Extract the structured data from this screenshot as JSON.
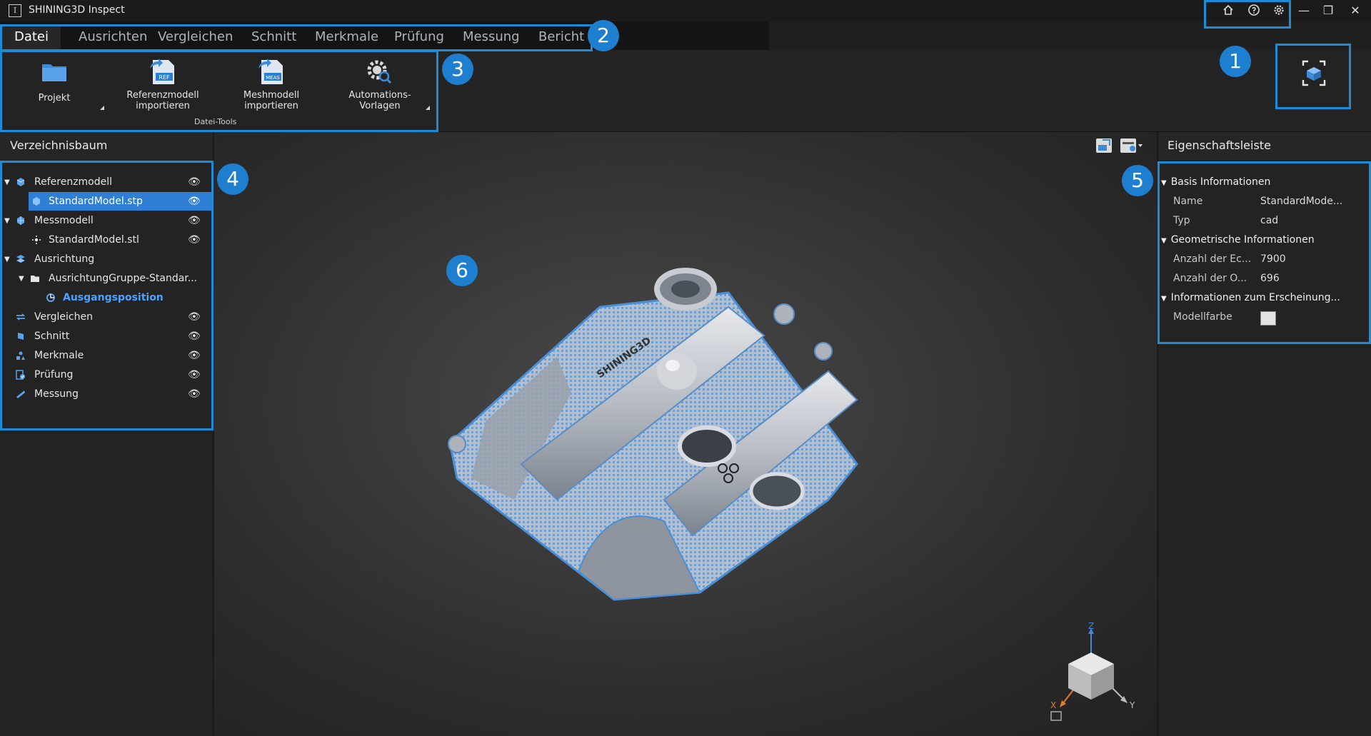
{
  "app": {
    "title": "SHINING3D Inspect",
    "logo_glyph": "I"
  },
  "titlebar_icons": [
    "home-icon",
    "help-icon",
    "settings-icon"
  ],
  "window_controls": {
    "minimize": "—",
    "maximize": "❐",
    "close": "✕"
  },
  "menu": {
    "tabs": [
      {
        "label": "Datei",
        "active": true
      },
      {
        "label": "Ausrichten"
      },
      {
        "label": "Vergleichen"
      },
      {
        "label": "Schnitt"
      },
      {
        "label": "Merkmale"
      },
      {
        "label": "Prüfung"
      },
      {
        "label": "Messung"
      },
      {
        "label": "Bericht"
      }
    ]
  },
  "ribbon": {
    "buttons": [
      {
        "label": "Projekt",
        "icon": "folder-icon"
      },
      {
        "label": "Referenzmodell\nimportieren",
        "icon": "import-ref-icon",
        "tag": "REF"
      },
      {
        "label": "Meshmodell\nimportieren",
        "icon": "import-mesh-icon",
        "tag": "MEAS"
      },
      {
        "label": "Automations-\nVorlagen",
        "icon": "gear-search-icon"
      }
    ],
    "group_label": "Datei-Tools"
  },
  "tree_panel": {
    "title": "Verzeichnisbaum",
    "items": [
      {
        "label": "Referenzmodell",
        "icon": "reference-model-icon",
        "expanded": true,
        "eye": true
      },
      {
        "label": "StandardModel.stp",
        "icon": "cad-part-icon",
        "selected": true,
        "eye": true
      },
      {
        "label": "Messmodell",
        "icon": "mesh-model-icon",
        "expanded": true,
        "eye": true
      },
      {
        "label": "StandardModel.stl",
        "icon": "point-cloud-icon",
        "eye": true
      },
      {
        "label": "Ausrichtung",
        "icon": "alignment-icon",
        "expanded": true
      },
      {
        "label": "AusrichtungGruppe-Standar...",
        "icon": "folder-icon",
        "expanded": true
      },
      {
        "label": "Ausgangsposition",
        "icon": "alignment-item-icon",
        "highlight": true
      },
      {
        "label": "Vergleichen",
        "icon": "compare-icon",
        "eye": true
      },
      {
        "label": "Schnitt",
        "icon": "section-icon",
        "eye": true
      },
      {
        "label": "Merkmale",
        "icon": "features-icon",
        "eye": true
      },
      {
        "label": "Prüfung",
        "icon": "check-icon",
        "eye": true
      },
      {
        "label": "Messung",
        "icon": "measure-icon",
        "eye": true
      }
    ]
  },
  "properties_panel": {
    "title": "Eigenschaftsleiste",
    "sections": [
      {
        "title": "Basis Informationen",
        "rows": [
          {
            "key": "Name",
            "value": "StandardMode..."
          },
          {
            "key": "Typ",
            "value": "cad"
          }
        ]
      },
      {
        "title": "Geometrische Informationen",
        "rows": [
          {
            "key": "Anzahl der Ec...",
            "value": "7900"
          },
          {
            "key": "Anzahl der O...",
            "value": "696"
          }
        ]
      },
      {
        "title": "Informationen zum Erscheinung...",
        "rows": [
          {
            "key": "Modellfarbe",
            "value": ""
          }
        ]
      }
    ],
    "model_color": "#e3e3e3"
  },
  "viewport": {
    "axis_labels": {
      "z": "Z",
      "x": "X",
      "y": "Y"
    },
    "model_text": "SHINING3D"
  },
  "annotations": [
    "1",
    "2",
    "3",
    "4",
    "5",
    "6"
  ],
  "colors": {
    "accent": "#1e8bd6",
    "selection": "#2f7fd6",
    "link": "#4aa3ff"
  }
}
